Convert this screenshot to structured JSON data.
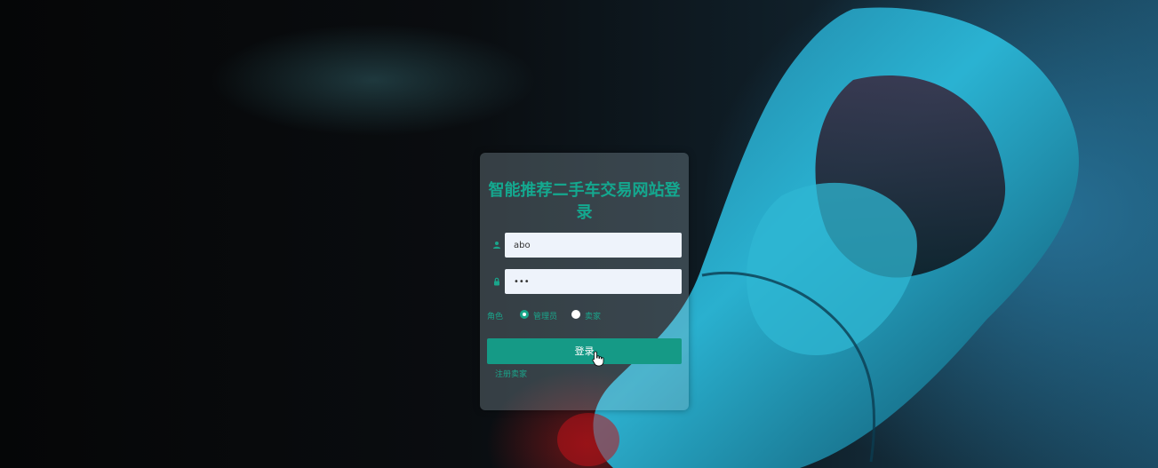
{
  "login": {
    "title": "智能推荐二手车交易网站登录",
    "username_value": "abo",
    "password_value": "•••",
    "role_label": "角色",
    "role_options": [
      "管理员",
      "卖家"
    ],
    "role_selected": "管理员",
    "login_button": "登录",
    "register_link": "注册卖家"
  },
  "icons": {
    "username": "user-icon",
    "password": "lock-icon",
    "pointer": "hand-cursor-icon"
  },
  "colors": {
    "accent": "#159a86",
    "title": "#14a88f",
    "input_bg": "#eef3fb"
  }
}
